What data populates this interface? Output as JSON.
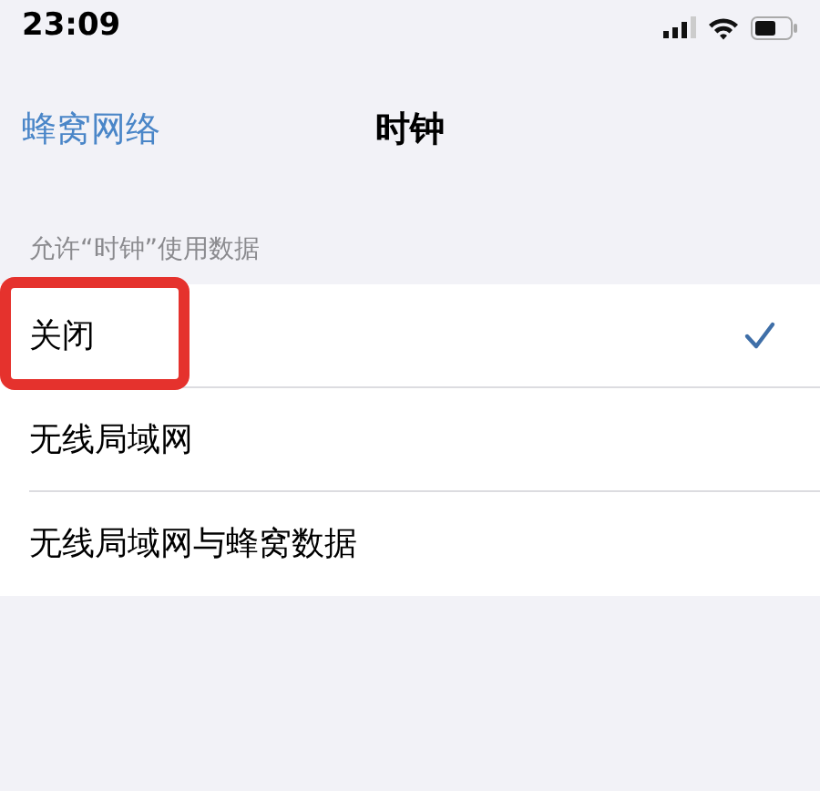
{
  "status_bar": {
    "time": "23:09"
  },
  "nav": {
    "back": "蜂窝网络",
    "title": "时钟"
  },
  "section": {
    "header": "允许“时钟”使用数据",
    "options": [
      {
        "label": "关闭",
        "selected": true,
        "highlighted": true
      },
      {
        "label": "无线局域网",
        "selected": false,
        "highlighted": false
      },
      {
        "label": "无线局域网与蜂窝数据",
        "selected": false,
        "highlighted": false
      }
    ]
  }
}
